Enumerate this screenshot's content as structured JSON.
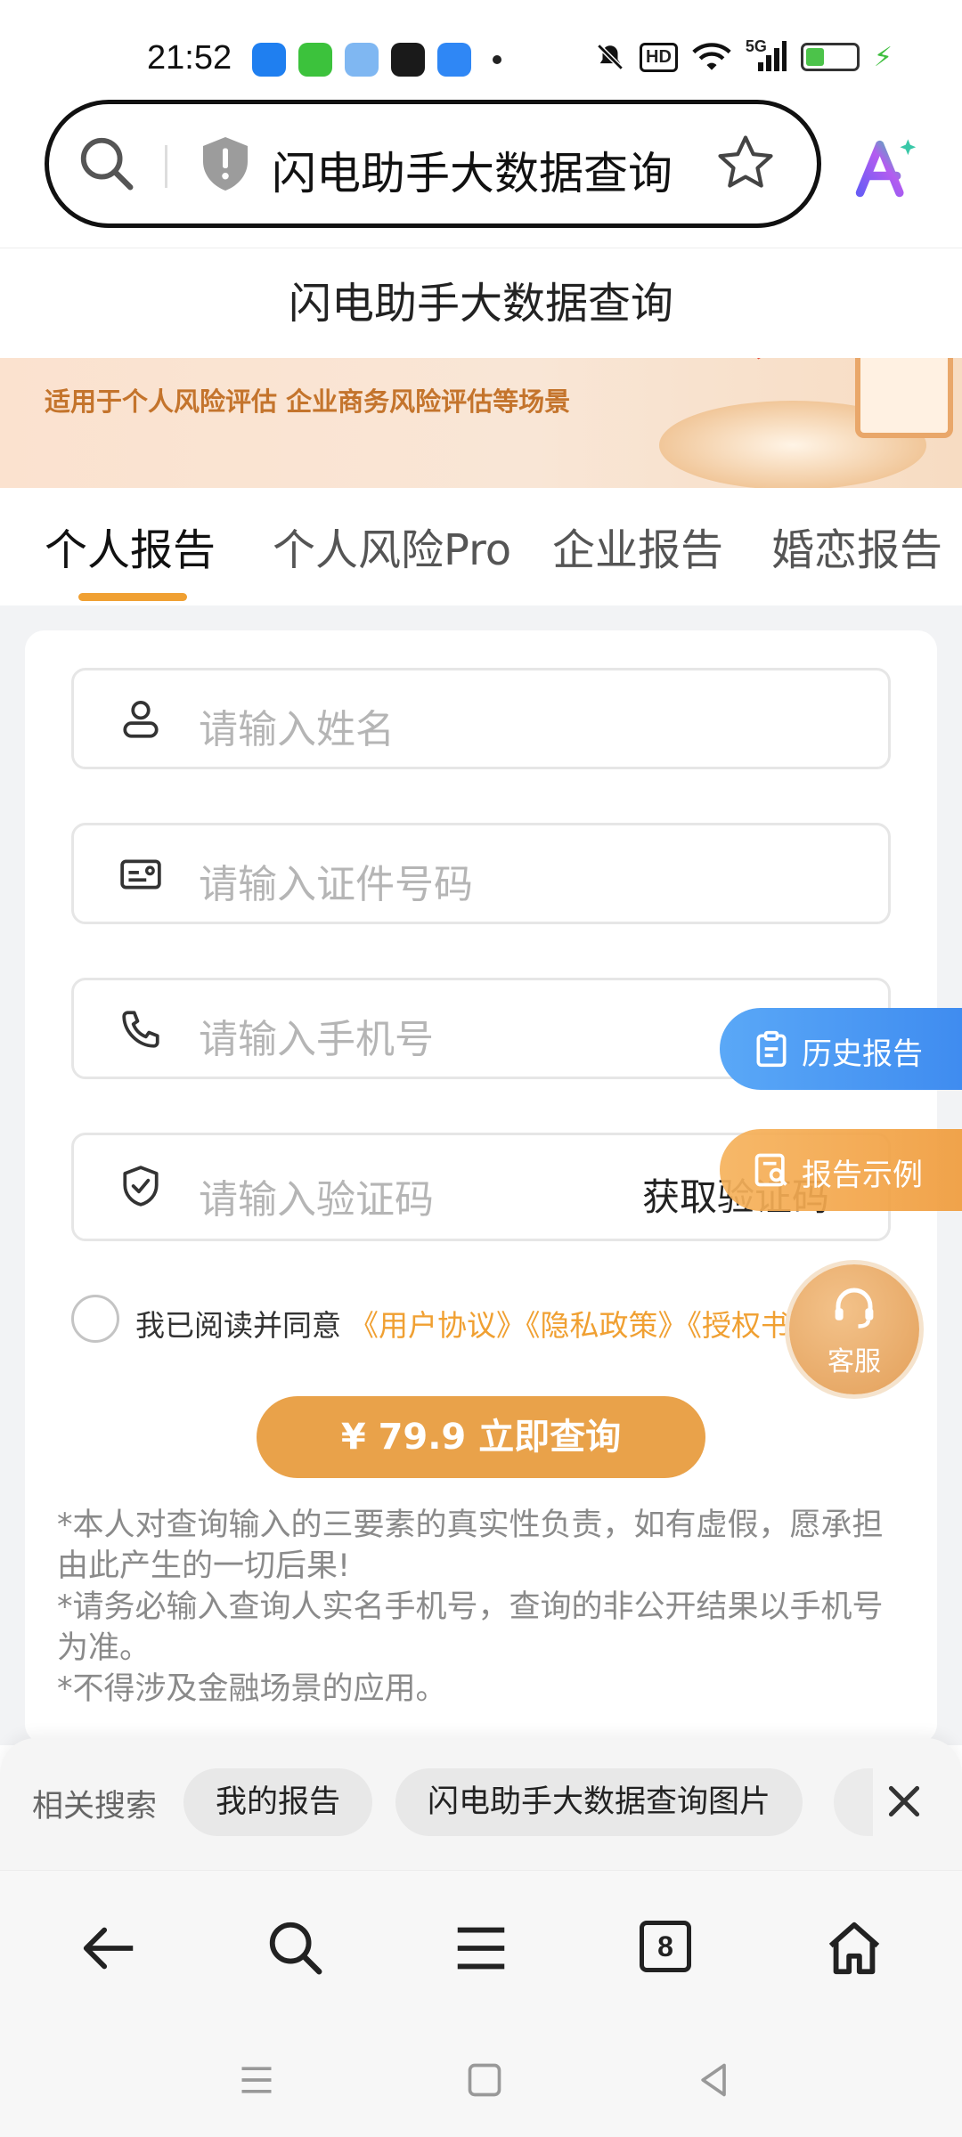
{
  "status_bar": {
    "time": "21:52",
    "hd_badge": "HD",
    "network": "5G",
    "app_icons": [
      "alipay-icon",
      "iqiyi-icon",
      "weather-icon",
      "music-icon",
      "browser-icon"
    ],
    "status_icons": [
      "mute-icon",
      "hd-icon",
      "wifi-icon",
      "signal-icon",
      "battery-icon",
      "charging-icon"
    ]
  },
  "browser": {
    "url_text": "闪电助手大数据查询"
  },
  "page": {
    "title": "闪电助手大数据查询",
    "banner_text": "适用于个人风险评估 企业商务风险评估等场景"
  },
  "tabs": [
    {
      "label": "个人报告",
      "active": true
    },
    {
      "label": "个人风险Pro",
      "active": false
    },
    {
      "label": "企业报告",
      "active": false
    },
    {
      "label": "婚恋报告",
      "active": false
    }
  ],
  "form": {
    "name_placeholder": "请输入姓名",
    "id_placeholder": "请输入证件号码",
    "phone_placeholder": "请输入手机号",
    "code_placeholder": "请输入验证码",
    "get_code_label": "获取验证码",
    "agree_prefix": "我已阅读并同意",
    "agree_links": "《用户协议》《隐私政策》《授权书》",
    "submit_label": "¥ 79.9 立即查询",
    "notes": [
      "*本人对查询输入的三要素的真实性负责，如有虚假，愿承担由此产生的一切后果!",
      "*请务必输入查询人实名手机号，查询的非公开结果以手机号为准。",
      "*不得涉及金融场景的应用。"
    ]
  },
  "floating": {
    "history_label": "历史报告",
    "sample_label": "报告示例",
    "service_label": "客服"
  },
  "related": {
    "label": "相关搜索",
    "chips": [
      "我的报告",
      "闪电助手大数据查询图片"
    ]
  },
  "bottom_nav": {
    "tab_count": "8"
  },
  "colors": {
    "accent": "#f0a032",
    "submit": "#e9a24a",
    "history_blue": "#4b9af5"
  }
}
